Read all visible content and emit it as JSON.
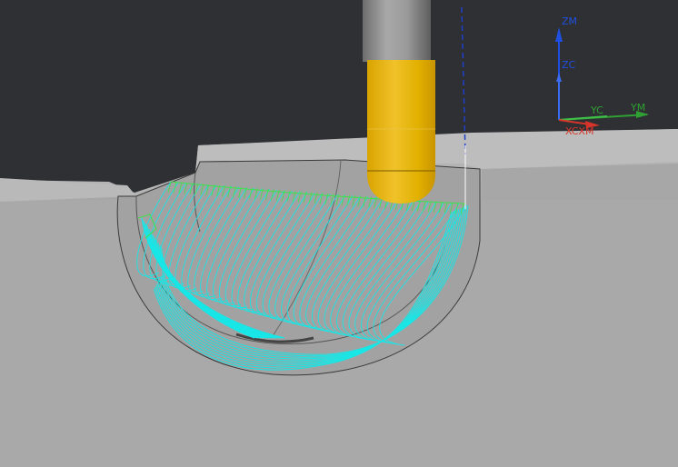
{
  "triad": {
    "zm_label": "ZM",
    "zc_label": "ZC",
    "yc_label": "YC",
    "ym_label": "YM",
    "xcxm_label": "XCXM",
    "z_color": "#1f4fe0",
    "y_color": "#2fa033",
    "x_color": "#d6342a"
  },
  "colors": {
    "background": "#2f3033",
    "part_top": "#b8b8b8",
    "part_front": "#a9a9a9",
    "pocket": "#a3a3a3",
    "toolpath_cyan": "#19e6e6",
    "toolpath_green": "#3ee24a",
    "tool_holder": "#8a8a8a",
    "tool_ball": "#e2b000"
  }
}
